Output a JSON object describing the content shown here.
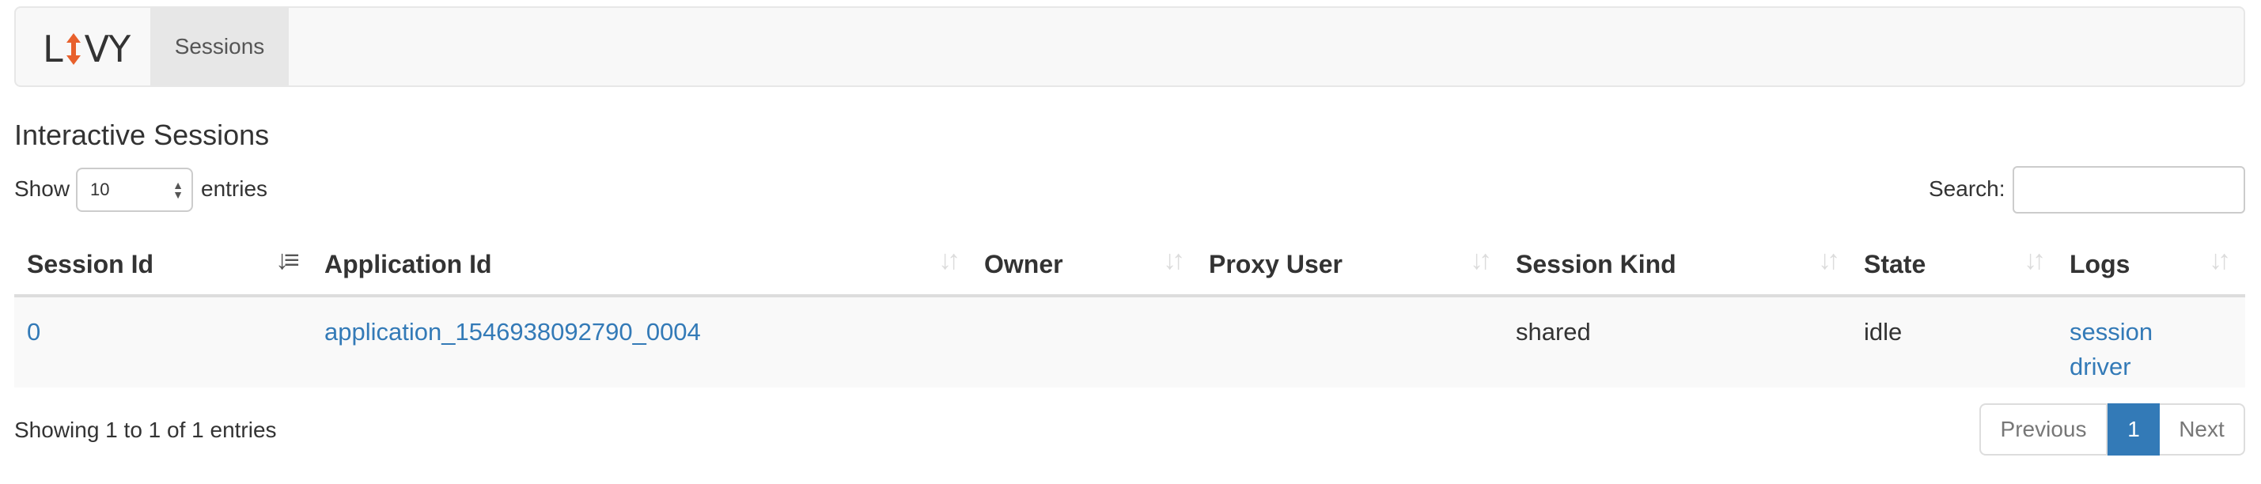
{
  "navbar": {
    "brand_left": "L",
    "brand_right": "VY",
    "items": [
      {
        "label": "Sessions"
      }
    ]
  },
  "page_title": "Interactive Sessions",
  "length_control": {
    "show_label": "Show",
    "value": "10",
    "entries_label": "entries"
  },
  "search": {
    "label": "Search:",
    "value": ""
  },
  "table": {
    "columns": [
      {
        "label": "Session Id",
        "sorted": "ascending"
      },
      {
        "label": "Application Id",
        "sorted": "none"
      },
      {
        "label": "Owner",
        "sorted": "none"
      },
      {
        "label": "Proxy User",
        "sorted": "none"
      },
      {
        "label": "Session Kind",
        "sorted": "none"
      },
      {
        "label": "State",
        "sorted": "none"
      },
      {
        "label": "Logs",
        "sorted": "none"
      }
    ],
    "rows": [
      {
        "session_id": "0",
        "application_id": "application_1546938092790_0004",
        "owner": "",
        "proxy_user": "",
        "session_kind": "shared",
        "state": "idle",
        "logs": [
          "session",
          "driver"
        ]
      }
    ]
  },
  "footer": {
    "info": "Showing 1 to 1 of 1 entries",
    "pagination": {
      "previous": "Previous",
      "current": "1",
      "next": "Next"
    }
  },
  "colors": {
    "link": "#337ab7",
    "accent_orange": "#e8602c",
    "active_page": "#337ab7"
  }
}
